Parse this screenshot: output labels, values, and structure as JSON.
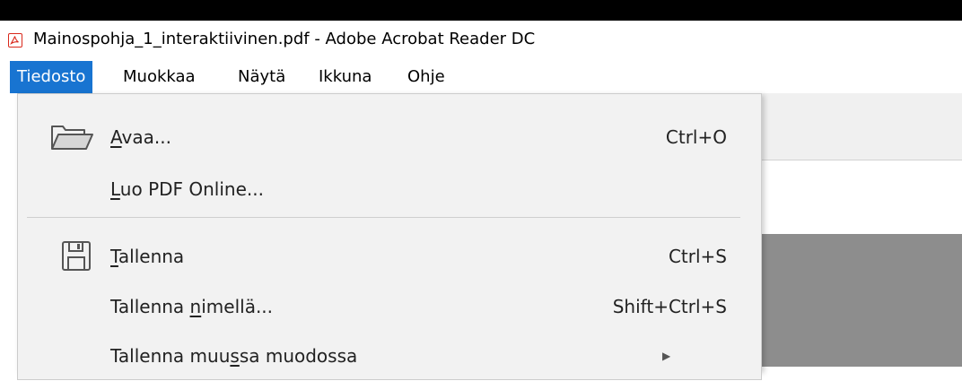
{
  "window": {
    "title": "Mainospohja_1_interaktiivinen.pdf - Adobe Acrobat Reader DC",
    "app_icon": "acrobat-reader-icon"
  },
  "menubar": {
    "items": [
      {
        "label": "Tiedosto",
        "active": true
      },
      {
        "label": "Muokkaa",
        "active": false
      },
      {
        "label": "Näytä",
        "active": false
      },
      {
        "label": "Ikkuna",
        "active": false
      },
      {
        "label": "Ohje",
        "active": false
      }
    ]
  },
  "file_menu": {
    "items": [
      {
        "label": "Avaa...",
        "accel_before": "",
        "accel_letter": "A",
        "accel_after": "vaa...",
        "shortcut": "Ctrl+O",
        "icon": "folder-open-icon"
      },
      {
        "label": "Luo PDF Online...",
        "accel_before": "",
        "accel_letter": "L",
        "accel_after": "uo PDF Online...",
        "shortcut": "",
        "icon": ""
      },
      {
        "label": "Tallenna",
        "accel_before": "",
        "accel_letter": "T",
        "accel_after": "allenna",
        "shortcut": "Ctrl+S",
        "icon": "save-icon"
      },
      {
        "label": "Tallenna nimellä...",
        "accel_before": "Tallenna ",
        "accel_letter": "n",
        "accel_after": "imellä...",
        "shortcut": "Shift+Ctrl+S",
        "icon": ""
      },
      {
        "label": "Tallenna muussa muodossa",
        "accel_before": "Tallenna muu",
        "accel_letter": "s",
        "accel_after": "sa muodossa",
        "shortcut": "",
        "icon": "",
        "submenu": true
      }
    ]
  },
  "colors": {
    "menu_active_bg": "#1874d1",
    "menu_bg": "#f2f2f2",
    "doc_grey": "#8d8d8d",
    "acrobat_red": "#d9291c"
  }
}
